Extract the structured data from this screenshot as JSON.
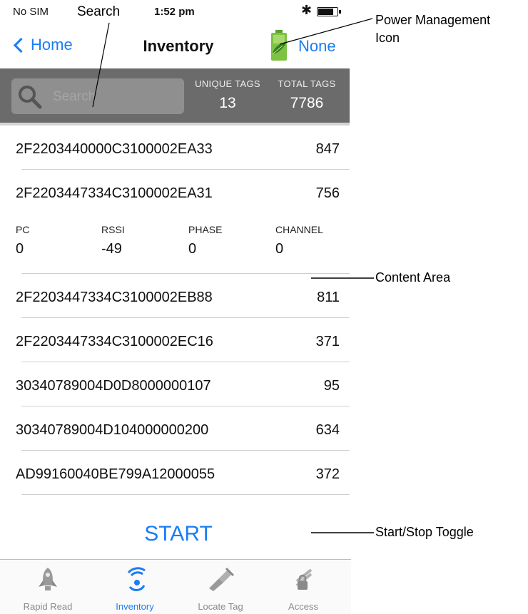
{
  "status_bar": {
    "carrier": "No SIM",
    "time": "1:52 pm"
  },
  "nav": {
    "back_label": "Home",
    "title": "Inventory",
    "reader_label": "None"
  },
  "header": {
    "search_placeholder": "Search",
    "unique_tags_label": "UNIQUE TAGS",
    "unique_tags_value": "13",
    "total_tags_label": "TOTAL TAGS",
    "total_tags_value": "7786"
  },
  "tags": [
    {
      "id": "2F2203440000C3100002EA33",
      "count": "847"
    },
    {
      "id": "2F2203447334C3100002EA31",
      "count": "756"
    },
    {
      "id": "2F2203447334C3100002EB88",
      "count": "811"
    },
    {
      "id": "2F2203447334C3100002EC16",
      "count": "371"
    },
    {
      "id": "30340789004D0D8000000107",
      "count": "95"
    },
    {
      "id": "30340789004D104000000200",
      "count": "634"
    },
    {
      "id": "AD99160040BE799A12000055",
      "count": "372"
    }
  ],
  "details": {
    "pc_label": "PC",
    "pc_value": "0",
    "rssi_label": "RSSI",
    "rssi_value": "-49",
    "phase_label": "PHASE",
    "phase_value": "0",
    "channel_label": "CHANNEL",
    "channel_value": "0"
  },
  "start_label": "START",
  "tabs": [
    {
      "label": "Rapid Read",
      "icon": "rocket-icon"
    },
    {
      "label": "Inventory",
      "icon": "rfid-signal-icon",
      "active": true
    },
    {
      "label": "Locate Tag",
      "icon": "flashlight-icon"
    },
    {
      "label": "Access",
      "icon": "lock-icon"
    }
  ],
  "annotations": {
    "search": "Search",
    "power": "Power Management Icon",
    "power_line1": "Power Management",
    "power_line2": "Icon",
    "content": "Content Area",
    "toggle": "Start/Stop Toggle"
  },
  "colors": {
    "accent": "#1a7cf6",
    "header_band": "#6b6b6b",
    "battery_green": "#7dc242"
  }
}
